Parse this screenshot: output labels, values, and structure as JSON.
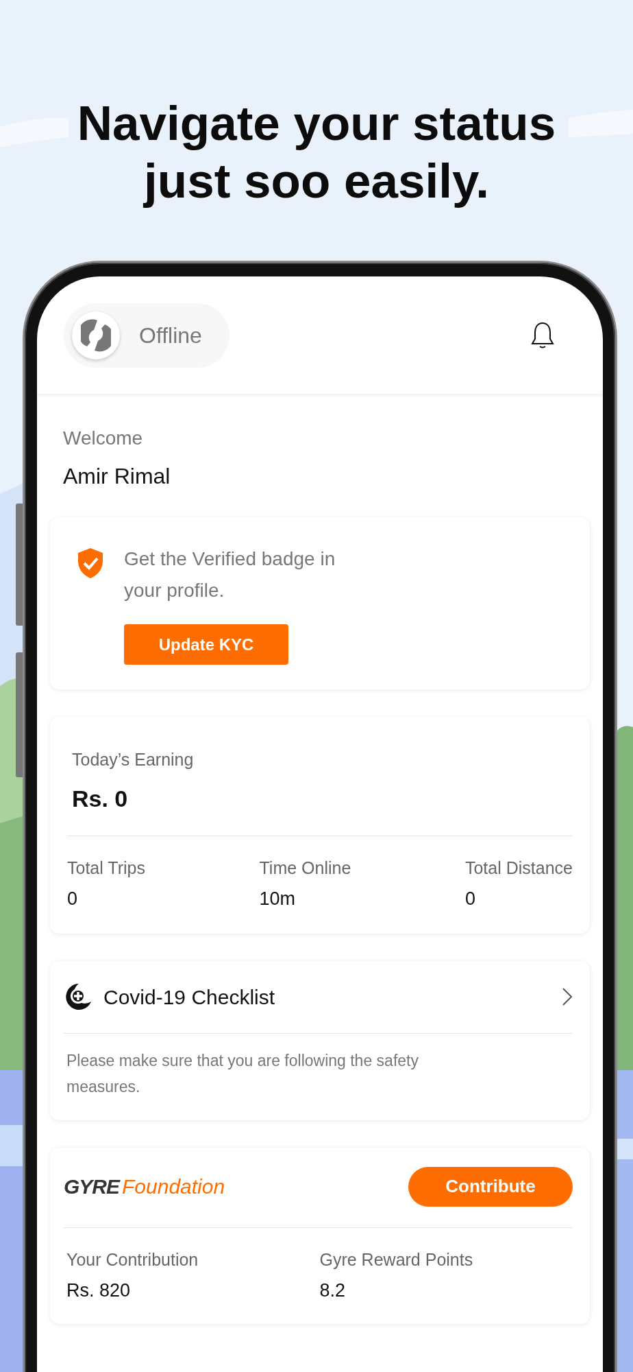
{
  "headline": "Navigate your status just soo easily.",
  "status": {
    "label": "Offline",
    "online": false
  },
  "welcome": {
    "greeting": "Welcome",
    "name": "Amir Rimal"
  },
  "kyc": {
    "message": "Get the Verified badge in your profile.",
    "button": "Update KYC"
  },
  "earnings": {
    "label": "Today’s Earning",
    "amount": "Rs. 0",
    "stats": [
      {
        "label": "Total Trips",
        "value": "0"
      },
      {
        "label": "Time Online",
        "value": "10m"
      },
      {
        "label": "Total Distance",
        "value": "0"
      }
    ]
  },
  "checklist": {
    "title": "Covid-19 Checklist",
    "note": "Please make sure that you are following the safety measures."
  },
  "foundation": {
    "brand": "GYRE",
    "name": "Foundation",
    "button": "Contribute",
    "stats": [
      {
        "label": "Your Contribution",
        "value": "Rs. 820"
      },
      {
        "label": "Gyre Reward Points",
        "value": "8.2"
      }
    ]
  }
}
